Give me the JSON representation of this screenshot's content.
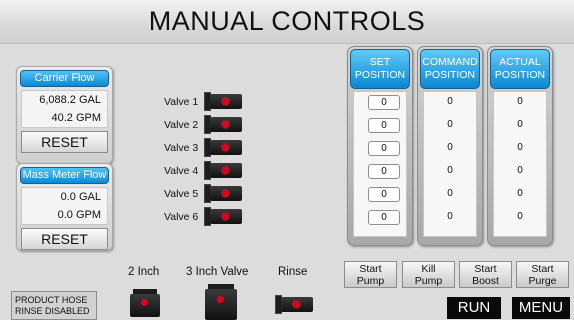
{
  "title": "MANUAL CONTROLS",
  "carrier_flow": {
    "label": "Carrier Flow",
    "gal_value": "6,088.2",
    "gal_unit": "GAL",
    "gpm_value": "40.2",
    "gpm_unit": "GPM",
    "reset_label": "RESET"
  },
  "mass_meter_flow": {
    "label": "Mass Meter Flow",
    "gal_value": "0.0",
    "gal_unit": "GAL",
    "gpm_value": "0.0",
    "gpm_unit": "GPM",
    "reset_label": "RESET"
  },
  "valves": [
    {
      "label": "Valve 1",
      "set": "0",
      "command": "0",
      "actual": "0"
    },
    {
      "label": "Valve 2",
      "set": "0",
      "command": "0",
      "actual": "0"
    },
    {
      "label": "Valve 3",
      "set": "0",
      "command": "0",
      "actual": "0"
    },
    {
      "label": "Valve 4",
      "set": "0",
      "command": "0",
      "actual": "0"
    },
    {
      "label": "Valve 5",
      "set": "0",
      "command": "0",
      "actual": "0"
    },
    {
      "label": "Valve 6",
      "set": "0",
      "command": "0",
      "actual": "0"
    }
  ],
  "columns": {
    "set_line1": "SET",
    "set_line2": "POSITION",
    "command_line1": "COMMAND",
    "command_line2": "POSITION",
    "actual_line1": "ACTUAL",
    "actual_line2": "POSITION"
  },
  "actions": {
    "start_pump_1": "Start",
    "start_pump_2": "Pump",
    "kill_pump_1": "Kill",
    "kill_pump_2": "Pump",
    "start_boost_1": "Start",
    "start_boost_2": "Boost",
    "start_purge_1": "Start",
    "start_purge_2": "Purge"
  },
  "bottom_valves": {
    "two_inch": "2 Inch",
    "three_inch": "3 Inch Valve",
    "rinse": "Rinse"
  },
  "notice": {
    "line1": "PRODUCT HOSE",
    "line2": "RINSE DISABLED"
  },
  "nav": {
    "run": "RUN",
    "menu": "MENU"
  },
  "colors": {
    "accent_blue": "#0a8ad6",
    "valve_led_red": "#e0001b",
    "background": "#dcdcdc"
  }
}
